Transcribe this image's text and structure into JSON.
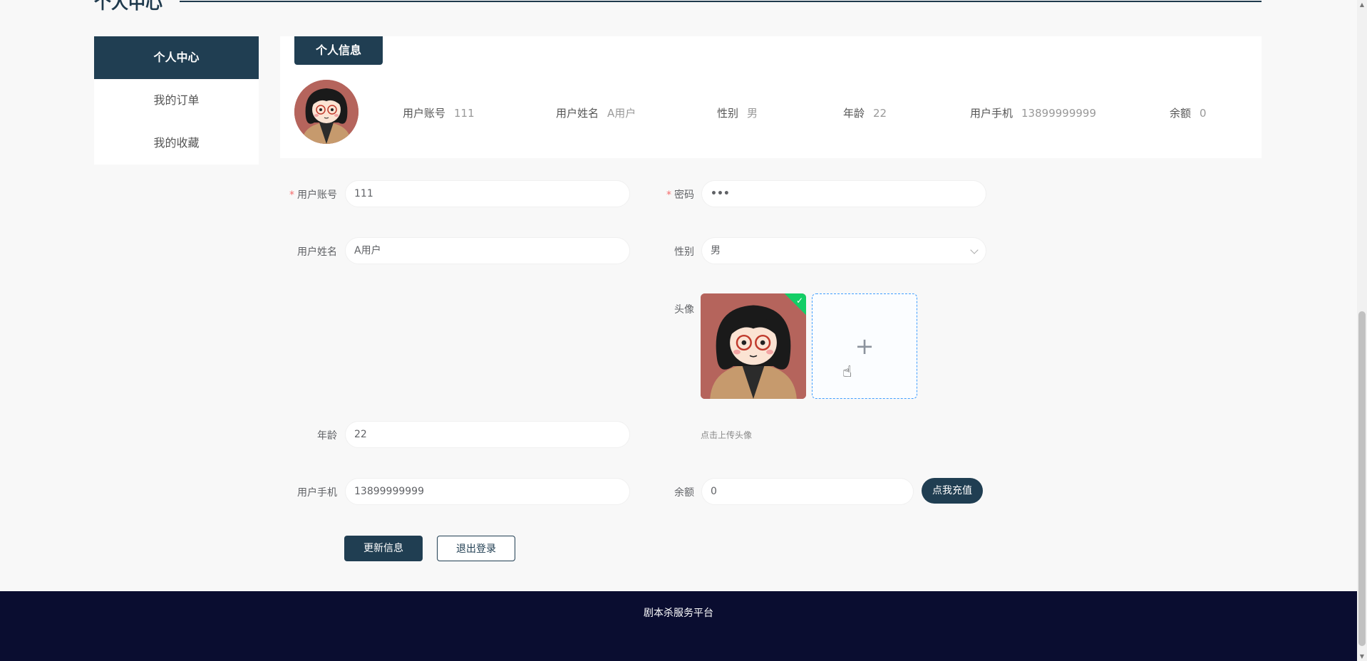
{
  "page": {
    "heading": "个人中心"
  },
  "sidebar": {
    "items": [
      {
        "label": "个人中心"
      },
      {
        "label": "我的订单"
      },
      {
        "label": "我的收藏"
      }
    ]
  },
  "info": {
    "tab": "个人信息",
    "fields": [
      {
        "label": "用户账号",
        "value": "111"
      },
      {
        "label": "用户姓名",
        "value": "A用户"
      },
      {
        "label": "性别",
        "value": "男"
      },
      {
        "label": "年龄",
        "value": "22"
      },
      {
        "label": "用户手机",
        "value": "13899999999"
      },
      {
        "label": "余额",
        "value": "0"
      }
    ]
  },
  "form": {
    "account": {
      "label": "用户账号",
      "value": "111",
      "required": true
    },
    "password": {
      "label": "密码",
      "value": "•••",
      "required": true
    },
    "name": {
      "label": "用户姓名",
      "value": "A用户"
    },
    "gender": {
      "label": "性别",
      "value": "男"
    },
    "avatar": {
      "label": "头像",
      "tip": "点击上传头像",
      "add_icon": "plus-icon"
    },
    "age": {
      "label": "年龄",
      "value": "22"
    },
    "phone": {
      "label": "用户手机",
      "value": "13899999999"
    },
    "balance": {
      "label": "余额",
      "value": "0",
      "recharge": "点我充值"
    },
    "update_button": "更新信息",
    "logout_button": "退出登录"
  },
  "footer": {
    "text": "剧本杀服务平台"
  },
  "colors": {
    "primary": "#203e52",
    "footer_bg": "#0a0d30",
    "required": "#f56c6c",
    "success": "#13ce66"
  }
}
